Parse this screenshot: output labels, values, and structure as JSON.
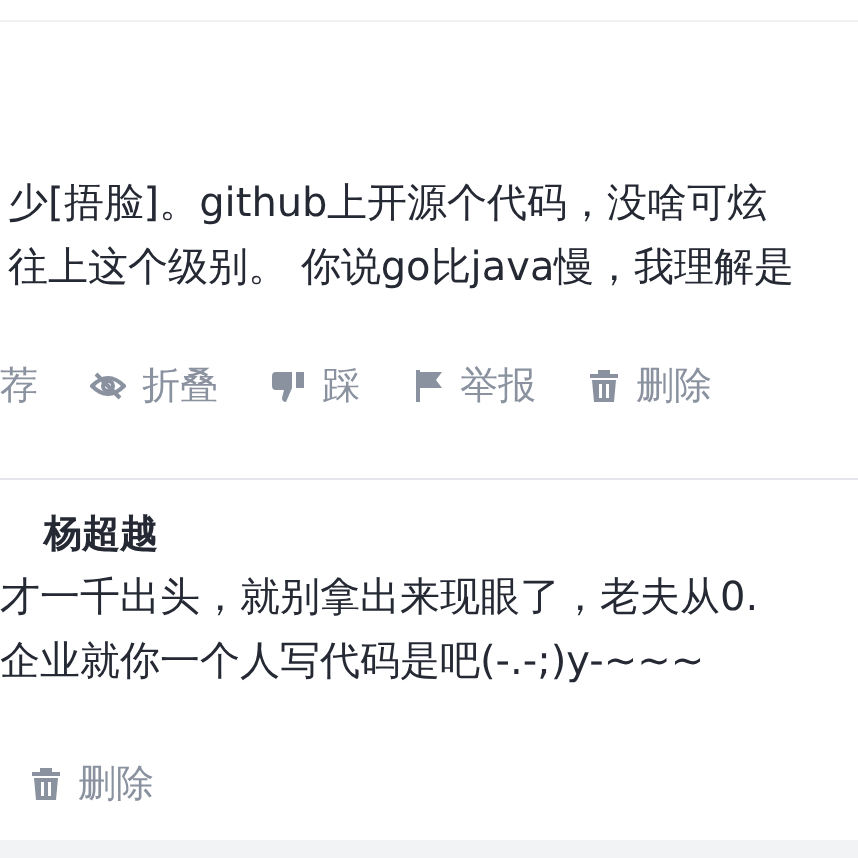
{
  "comments": [
    {
      "lines": [
        "少[捂脸]。github上开源个代码，没啥可炫",
        "往上这个级别。 你说go比java慢，我理解是"
      ],
      "actions": [
        {
          "kind": "recommend",
          "label": "荐"
        },
        {
          "kind": "fold",
          "label": "折叠"
        },
        {
          "kind": "dislike",
          "label": "踩"
        },
        {
          "kind": "report",
          "label": "举报"
        },
        {
          "kind": "delete",
          "label": "删除"
        }
      ]
    },
    {
      "author": "杨超越",
      "lines": [
        "才一千出头，就别拿出来现眼了，老夫从0.",
        "企业就你一个人写代码是吧(-.-;)y-~~~"
      ],
      "actions": [
        {
          "kind": "delete",
          "label": "删除"
        }
      ]
    }
  ]
}
